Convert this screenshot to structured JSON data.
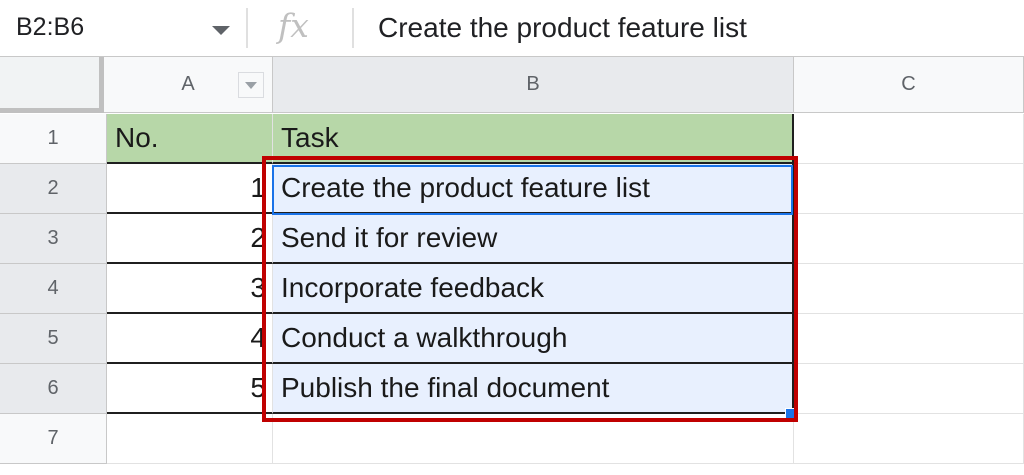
{
  "formula_bar": {
    "name_box": "B2:B6",
    "fx_label": "fx",
    "content": "Create the product feature list"
  },
  "columns": [
    "A",
    "B",
    "C"
  ],
  "rows": [
    "1",
    "2",
    "3",
    "4",
    "5",
    "6",
    "7"
  ],
  "cells": {
    "A1": "No.",
    "B1": "Task",
    "A2": "1",
    "B2": "Create the product feature list",
    "A3": "2",
    "B3": "Send it for review",
    "A4": "3",
    "B4": "Incorporate feedback",
    "A5": "4",
    "B5": "Conduct a walkthrough",
    "A6": "5",
    "B6": "Publish the final document"
  },
  "colors": {
    "header_fill": "#b7d7a8",
    "selection_fill": "#e8f0fe",
    "active_border": "#1a73e8",
    "annotation_border": "#c00000"
  }
}
